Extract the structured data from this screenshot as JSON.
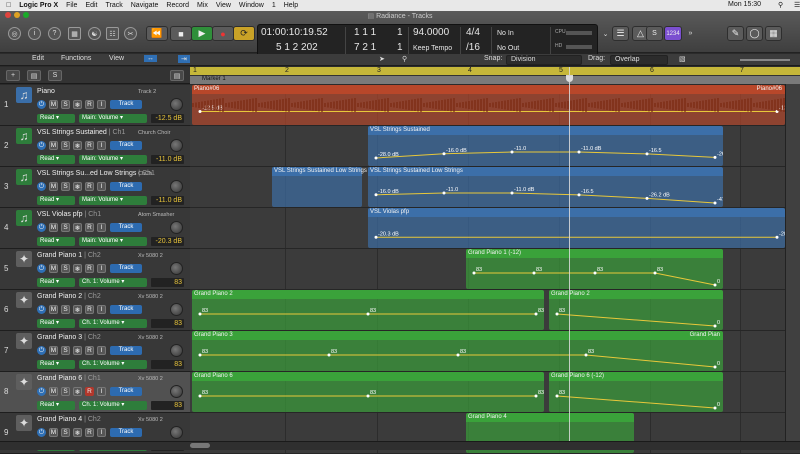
{
  "menubar": {
    "apple": "",
    "app": "Logic Pro X",
    "items": [
      "File",
      "Edit",
      "Track",
      "Navigate",
      "Record",
      "Mix",
      "View",
      "Window",
      "1",
      "Help"
    ],
    "clock": "Mon 15:30"
  },
  "window": {
    "title": "Radiance - Tracks"
  },
  "lcd": {
    "position": "01:00:10:19.52",
    "bars": "5  1  2  202",
    "sub1": "1  1  1",
    "sub2": "7  2  1",
    "sub1b": "1",
    "sub2b": "1",
    "tempo": "94.0000",
    "tempo_mode": "Keep Tempo",
    "sig": "4/4",
    "div": "/16",
    "in": "No In",
    "out": "No Out",
    "cpu": "CPU",
    "hd": "HD"
  },
  "tuner": "1234",
  "toolbar2": {
    "edit": "Edit",
    "functions": "Functions",
    "view": "View",
    "snap_label": "Snap:",
    "snap_value": "Division",
    "drag_label": "Drag:",
    "drag_value": "Overlap"
  },
  "track_header": {
    "add": "+",
    "s": "S"
  },
  "ruler": {
    "bars": [
      "1",
      "2",
      "3",
      "4",
      "5",
      "6",
      "7"
    ],
    "marker": "Marker 1"
  },
  "tracks": [
    {
      "num": "1",
      "name": "Piano",
      "cat": "",
      "plugin": "Track 2",
      "read": "Read",
      "auto": "Main: Volume",
      "value": "-12.5 dB",
      "mode": "Track",
      "color": "#c05a2a"
    },
    {
      "num": "2",
      "name": "VSL Strings Sustained",
      "cat": " | Ch1",
      "plugin": "Church Choir",
      "read": "Read",
      "auto": "Main: Volume",
      "value": "-11.0 dB",
      "mode": "Track",
      "color": "#2d5f9a"
    },
    {
      "num": "3",
      "name": "VSL Strings Su...ed Low Strings",
      "cat": " | Ch1",
      "plugin": "ChCh",
      "read": "Read",
      "auto": "Main: Volume",
      "value": "-11.0 dB",
      "mode": "Track",
      "color": "#2d5f9a"
    },
    {
      "num": "4",
      "name": "VSL Violas pfp",
      "cat": " | Ch1",
      "plugin": "Atom Smasher",
      "read": "Read",
      "auto": "Main: Volume",
      "value": "-20.3 dB",
      "mode": "Track",
      "color": "#2d5f9a"
    },
    {
      "num": "5",
      "name": "Grand Piano 1",
      "cat": " | Ch2",
      "plugin": "Xv 5080 2",
      "read": "Read",
      "auto": "Ch. 1: Volume",
      "value": "83",
      "mode": "Track",
      "color": "#2f8a2f"
    },
    {
      "num": "6",
      "name": "Grand Piano 2",
      "cat": " | Ch2",
      "plugin": "Xv 5080 2",
      "read": "Read",
      "auto": "Ch. 1: Volume",
      "value": "83",
      "mode": "Track",
      "color": "#2f8a2f"
    },
    {
      "num": "7",
      "name": "Grand Piano 3",
      "cat": " | Ch2",
      "plugin": "Xv 5080 2",
      "read": "Read",
      "auto": "Ch. 1: Volume",
      "value": "83",
      "mode": "Track",
      "color": "#2f8a2f"
    },
    {
      "num": "8",
      "name": "Grand Piano 6",
      "cat": " | Ch1",
      "plugin": "Xv 5080 2",
      "read": "Read",
      "auto": "Ch. 1: Volume",
      "value": "83",
      "mode": "Track",
      "color": "#2f8a2f"
    },
    {
      "num": "9",
      "name": "Grand Piano 4",
      "cat": " | Ch2",
      "plugin": "Xv 5080 2",
      "read": "Read",
      "auto": "",
      "value": "",
      "mode": "Track",
      "color": "#2f8a2f"
    }
  ],
  "regions": [
    {
      "track": 0,
      "label": "Piano#06",
      "right": "Piano#06",
      "color": "#b8472a",
      "audio": true,
      "from": 0,
      "to": 1,
      "dB": [
        "-12.5 dB",
        "-12.5 dB"
      ]
    },
    {
      "track": 1,
      "label": "VSL Strings Sustained",
      "color": "#3c6fa9",
      "from": 0.295,
      "to": 0.895,
      "dB": [
        "-28.0 dB",
        "-16.0 dB",
        "-11.0",
        "-11.0 dB",
        "-16.5",
        "-26.2 dB"
      ]
    },
    {
      "track": 2,
      "label": "VSL Strings Sustained Low Strings",
      "color": "#3c6fa9",
      "from": 0.135,
      "to": 0.29,
      "dB": []
    },
    {
      "track": 2,
      "label": "VSL Strings Sustained Low Strings",
      "color": "#3c6fa9",
      "from": 0.295,
      "to": 0.895,
      "dB": [
        "-16.0 dB",
        "-11.0",
        "-11.0 dB",
        "-16.5",
        "-26.2 dB",
        "-47.1"
      ]
    },
    {
      "track": 3,
      "label": "VSL Violas pfp",
      "color": "#3c6fa9",
      "from": 0.295,
      "to": 1,
      "dB": [
        "-20.3 dB",
        "-20.3 dB"
      ]
    },
    {
      "track": 4,
      "label": "Grand Piano 1 (-12)",
      "color": "#3aa23a",
      "from": 0.46,
      "to": 0.895,
      "dB": [
        "83",
        "83",
        "83",
        "83",
        "0"
      ]
    },
    {
      "track": 5,
      "label": "Grand Piano 2",
      "color": "#3aa23a",
      "from": 0,
      "to": 0.595,
      "dB": [
        "83",
        "83",
        "83"
      ]
    },
    {
      "track": 5,
      "label": "Grand Piano 2",
      "color": "#3aa23a",
      "from": 0.6,
      "to": 0.895,
      "dB": [
        "83",
        "0"
      ]
    },
    {
      "track": 6,
      "label": "Grand Piano 3",
      "color": "#3aa23a",
      "from": 0,
      "to": 0.895,
      "right": "Grand Pian",
      "dB": [
        "83",
        "83",
        "83",
        "83",
        "0"
      ]
    },
    {
      "track": 7,
      "label": "Grand Piano 6",
      "color": "#3aa23a",
      "from": 0,
      "to": 0.595,
      "dB": [
        "83",
        "83",
        "83"
      ]
    },
    {
      "track": 7,
      "label": "Grand Piano 6 (-12)",
      "color": "#3aa23a",
      "from": 0.6,
      "to": 0.895,
      "dB": [
        "83",
        "0"
      ]
    },
    {
      "track": 8,
      "label": "Grand Piano 4",
      "color": "#3aa23a",
      "from": 0.46,
      "to": 0.745,
      "dB": []
    }
  ]
}
